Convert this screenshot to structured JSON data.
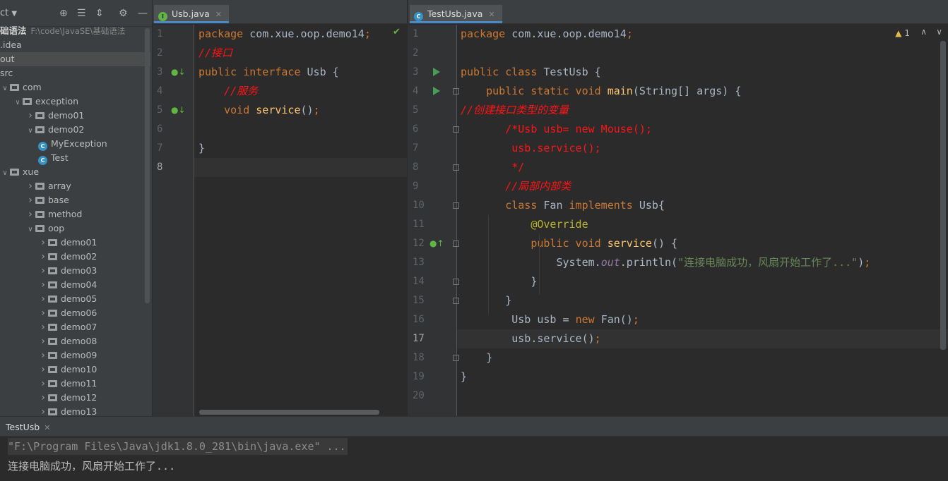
{
  "project_panel": {
    "title": "ct",
    "tree": [
      {
        "label": "础语法",
        "path": "F:\\code\\JavaSE\\基础语法",
        "kind": "root",
        "depth": 0
      },
      {
        "label": ".idea",
        "kind": "folder",
        "depth": 0
      },
      {
        "label": "out",
        "kind": "folder",
        "depth": 0,
        "selected": true
      },
      {
        "label": "src",
        "kind": "folder",
        "depth": 0
      },
      {
        "label": "com",
        "kind": "package",
        "depth": 0,
        "expanded": true
      },
      {
        "label": "exception",
        "kind": "package",
        "depth": 1,
        "expanded": true
      },
      {
        "label": "demo01",
        "kind": "package",
        "depth": 2,
        "expanded": false
      },
      {
        "label": "demo02",
        "kind": "package",
        "depth": 2,
        "expanded": true
      },
      {
        "label": "MyException",
        "kind": "class",
        "depth": 3
      },
      {
        "label": "Test",
        "kind": "class",
        "depth": 3
      },
      {
        "label": "xue",
        "kind": "package",
        "depth": 0,
        "expanded": true
      },
      {
        "label": "array",
        "kind": "package",
        "depth": 2,
        "expanded": false
      },
      {
        "label": "base",
        "kind": "package",
        "depth": 2,
        "expanded": false
      },
      {
        "label": "method",
        "kind": "package",
        "depth": 2,
        "expanded": false
      },
      {
        "label": "oop",
        "kind": "package",
        "depth": 2,
        "expanded": true
      },
      {
        "label": "demo01",
        "kind": "package",
        "depth": 3,
        "expanded": false
      },
      {
        "label": "demo02",
        "kind": "package",
        "depth": 3,
        "expanded": false
      },
      {
        "label": "demo03",
        "kind": "package",
        "depth": 3,
        "expanded": false
      },
      {
        "label": "demo04",
        "kind": "package",
        "depth": 3,
        "expanded": false
      },
      {
        "label": "demo05",
        "kind": "package",
        "depth": 3,
        "expanded": false
      },
      {
        "label": "demo06",
        "kind": "package",
        "depth": 3,
        "expanded": false
      },
      {
        "label": "demo07",
        "kind": "package",
        "depth": 3,
        "expanded": false
      },
      {
        "label": "demo08",
        "kind": "package",
        "depth": 3,
        "expanded": false
      },
      {
        "label": "demo09",
        "kind": "package",
        "depth": 3,
        "expanded": false
      },
      {
        "label": "demo10",
        "kind": "package",
        "depth": 3,
        "expanded": false
      },
      {
        "label": "demo11",
        "kind": "package",
        "depth": 3,
        "expanded": false
      },
      {
        "label": "demo12",
        "kind": "package",
        "depth": 3,
        "expanded": false
      },
      {
        "label": "demo13",
        "kind": "package",
        "depth": 3,
        "expanded": false
      }
    ]
  },
  "editor_left": {
    "tab": {
      "label": "Usb.java",
      "icon": "interface-icon",
      "icon_letter": "I"
    },
    "current_line": 8,
    "lines": [
      [
        [
          "kw",
          "package "
        ],
        [
          "tx",
          "com.xue.oop.demo14"
        ],
        [
          "kw",
          ";"
        ]
      ],
      [
        [
          "cm",
          "//接口"
        ]
      ],
      [
        [
          "kw",
          "public interface "
        ],
        [
          "tx",
          "Usb {"
        ]
      ],
      [
        [
          "tx",
          "    "
        ],
        [
          "cm",
          "//服务"
        ]
      ],
      [
        [
          "tx",
          "    "
        ],
        [
          "kw",
          "void "
        ],
        [
          "fn",
          "service"
        ],
        [
          "tx",
          "()"
        ],
        [
          "kw",
          ";"
        ]
      ],
      [
        [
          "tx",
          ""
        ]
      ],
      [
        [
          "tx",
          "}"
        ]
      ],
      [
        [
          "tx",
          ""
        ]
      ]
    ]
  },
  "editor_right": {
    "tab": {
      "label": "TestUsb.java",
      "icon": "class-icon",
      "icon_letter": "C"
    },
    "warning_count": "1",
    "current_line": 17,
    "lines": [
      [
        [
          "kw",
          "package "
        ],
        [
          "tx",
          "com.xue.oop.demo14"
        ],
        [
          "kw",
          ";"
        ]
      ],
      [
        [
          "tx",
          ""
        ]
      ],
      [
        [
          "kw",
          "public class "
        ],
        [
          "tx",
          "TestUsb {"
        ]
      ],
      [
        [
          "tx",
          "    "
        ],
        [
          "kw",
          "public static void "
        ],
        [
          "fn",
          "main"
        ],
        [
          "tx",
          "(String[] args) {"
        ]
      ],
      [
        [
          "cm",
          "//创建接口类型的变量"
        ]
      ],
      [
        [
          "tx",
          "       "
        ],
        [
          "cmr",
          "/*Usb usb= new Mouse();"
        ]
      ],
      [
        [
          "tx",
          "        "
        ],
        [
          "cmr",
          "usb.service();"
        ]
      ],
      [
        [
          "tx",
          "        "
        ],
        [
          "cmr",
          "*/"
        ]
      ],
      [
        [
          "tx",
          "       "
        ],
        [
          "cm",
          "//局部内部类"
        ]
      ],
      [
        [
          "tx",
          "       "
        ],
        [
          "kw",
          "class "
        ],
        [
          "tx",
          "Fan "
        ],
        [
          "kw",
          "implements "
        ],
        [
          "tx",
          "Usb{"
        ]
      ],
      [
        [
          "tx",
          "           "
        ],
        [
          "an",
          "@Override"
        ]
      ],
      [
        [
          "tx",
          "           "
        ],
        [
          "kw",
          "public void "
        ],
        [
          "fn",
          "service"
        ],
        [
          "tx",
          "() {"
        ]
      ],
      [
        [
          "tx",
          "               System."
        ],
        [
          "pf",
          "out"
        ],
        [
          "tx",
          ".println("
        ],
        [
          "st",
          "\"连接电脑成功，风扇开始工作了...\""
        ],
        [
          "tx",
          ")"
        ],
        [
          "kw",
          ";"
        ]
      ],
      [
        [
          "tx",
          "           }"
        ]
      ],
      [
        [
          "tx",
          "       }"
        ]
      ],
      [
        [
          "tx",
          "        Usb usb = "
        ],
        [
          "kw",
          "new "
        ],
        [
          "tx",
          "Fan()"
        ],
        [
          "kw",
          ";"
        ]
      ],
      [
        [
          "tx",
          "        usb.service()"
        ],
        [
          "kw",
          ";"
        ]
      ],
      [
        [
          "tx",
          "    }"
        ]
      ],
      [
        [
          "tx",
          "}"
        ]
      ],
      [
        [
          "tx",
          ""
        ]
      ]
    ]
  },
  "run_panel": {
    "tab_label": "TestUsb",
    "output": [
      "\"F:\\Program Files\\Java\\jdk1.8.0_281\\bin\\java.exe\" ...",
      "连接电脑成功，风扇开始工作了..."
    ]
  }
}
